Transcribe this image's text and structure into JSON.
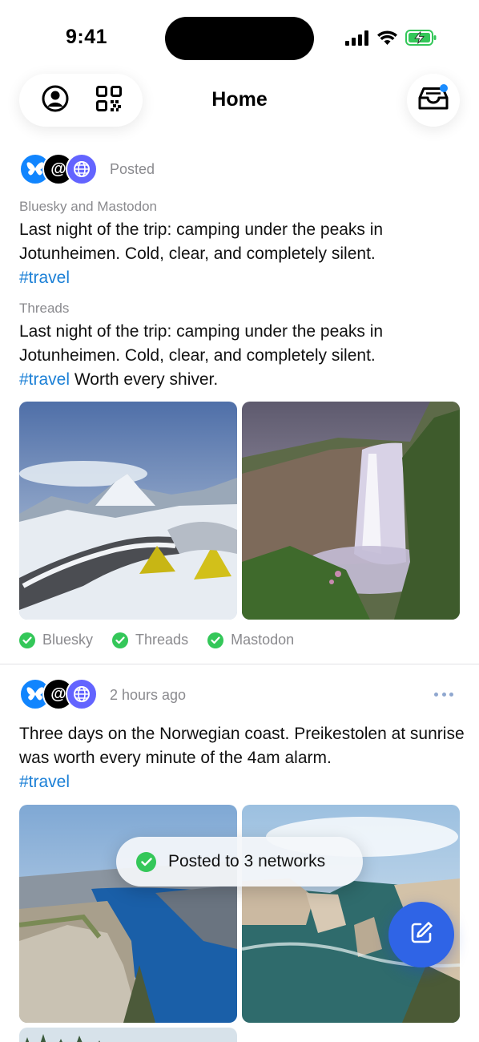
{
  "status_bar": {
    "time": "9:41"
  },
  "header": {
    "title": "Home"
  },
  "colors": {
    "accent": "#2f64e6",
    "hashtag": "#1a7fd6",
    "success": "#34c759",
    "badge": "#1a8cff",
    "bluesky": "#1185fe",
    "mastodon": "#6364ff"
  },
  "icons": [
    "profile-icon",
    "qr-code-icon",
    "inbox-icon",
    "butterfly-icon",
    "threads-icon",
    "globe-icon",
    "checkmark-icon",
    "ellipsis-icon",
    "compose-icon",
    "cellular-signal-icon",
    "wifi-icon",
    "battery-charging-icon"
  ],
  "posts": [
    {
      "meta": "Posted",
      "variants": [
        {
          "network_label": "Bluesky and Mastodon",
          "text": "Last night of the trip: camping under the peaks in Jotunheimen. Cold, clear, and completely silent.",
          "hashtag": "#travel",
          "after": ""
        },
        {
          "network_label": "Threads",
          "text": "Last night of the trip: camping under the peaks in Jotunheimen. Cold, clear, and completely silent.",
          "hashtag": "#travel",
          "after": " Worth every shiver."
        }
      ],
      "posted_to": [
        "Bluesky",
        "Threads",
        "Mastodon"
      ]
    },
    {
      "meta": "2 hours ago",
      "text": "Three days on the Norwegian coast. Preikestolen at sunrise was worth every minute of the 4am alarm.",
      "hashtag": "#travel"
    }
  ],
  "toast": {
    "text": "Posted to 3 networks"
  }
}
